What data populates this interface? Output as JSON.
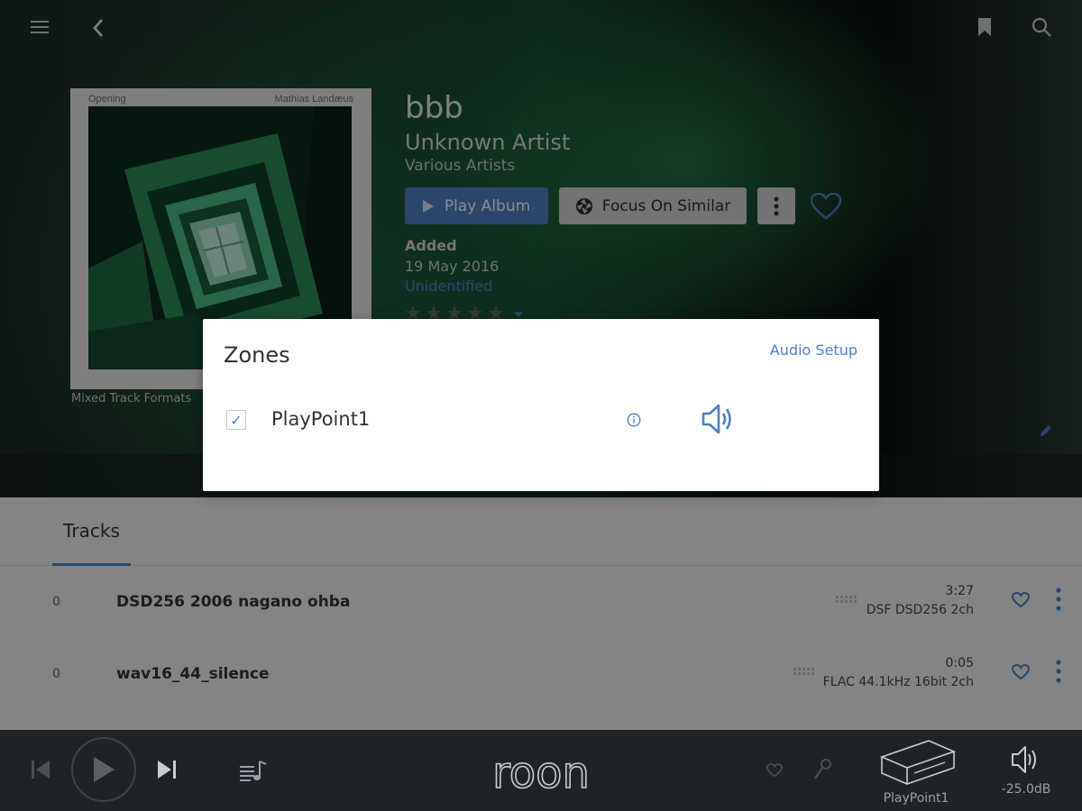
{
  "album": {
    "title": "bbb",
    "artist": "Unknown Artist",
    "album_artist": "Various Artists",
    "art_top_left": "Opening",
    "art_top_right": "Mathias Landæus",
    "subtitle": "Mixed Track Formats",
    "play_label": "Play Album",
    "focus_label": "Focus On Similar",
    "added_label": "Added",
    "added_date": "19 May 2016",
    "identification": "Unidentified"
  },
  "tabs": {
    "tracks": "Tracks"
  },
  "tracks": [
    {
      "number": "0",
      "name": "DSD256 2006 nagano ohba",
      "duration": "3:27",
      "format": "DSF DSD256 2ch"
    },
    {
      "number": "0",
      "name": "wav16_44_silence",
      "duration": "0:05",
      "format": "FLAC 44.1kHz 16bit 2ch"
    }
  ],
  "zones_dialog": {
    "title": "Zones",
    "audio_setup": "Audio Setup",
    "zones": [
      {
        "name": "PlayPoint1",
        "checked": true
      }
    ]
  },
  "player": {
    "logo": "roon",
    "zone_name": "PlayPoint1",
    "volume": "-25.0dB"
  },
  "icons": {
    "menu": "menu-icon",
    "back": "back-arrow-icon",
    "bookmark": "bookmark-icon",
    "search": "search-icon",
    "heart": "heart-icon",
    "more": "more-vertical-icon",
    "edit": "pencil-icon",
    "info": "info-icon",
    "speaker": "speaker-icon",
    "prev": "skip-previous-icon",
    "play": "play-icon",
    "next": "skip-next-icon",
    "queue": "queue-icon",
    "mic": "microphone-icon",
    "device": "device-icon"
  },
  "colors": {
    "accent": "#4f80c4",
    "player_bg": "#1f2328",
    "content_bg": "#eff0f0"
  }
}
